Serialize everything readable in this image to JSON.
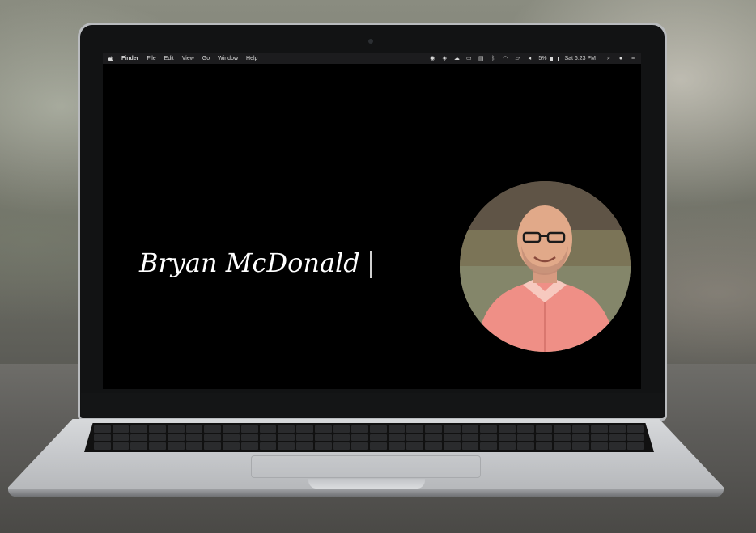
{
  "menubar": {
    "app_name": "Finder",
    "items": [
      "File",
      "Edit",
      "View",
      "Go",
      "Window",
      "Help"
    ],
    "battery_percent": "5%",
    "clock": "Sat 6:23 PM"
  },
  "hero": {
    "name": "Bryan McDonald"
  },
  "icons": [
    "apple-icon",
    "record-icon",
    "dropbox-icon",
    "cloud-icon",
    "monitor-icon",
    "bluetooth-icon",
    "wifi-icon",
    "airplay-icon",
    "volume-icon",
    "battery-icon",
    "search-icon",
    "user-icon",
    "notification-list-icon"
  ]
}
